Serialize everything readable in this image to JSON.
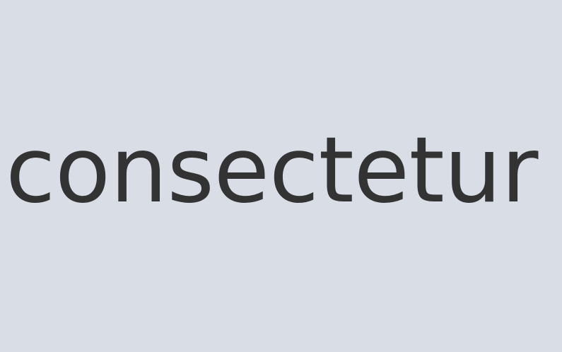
{
  "content": {
    "word": "consectetur"
  },
  "colors": {
    "background": "#d9dee6",
    "text": "#333333"
  }
}
